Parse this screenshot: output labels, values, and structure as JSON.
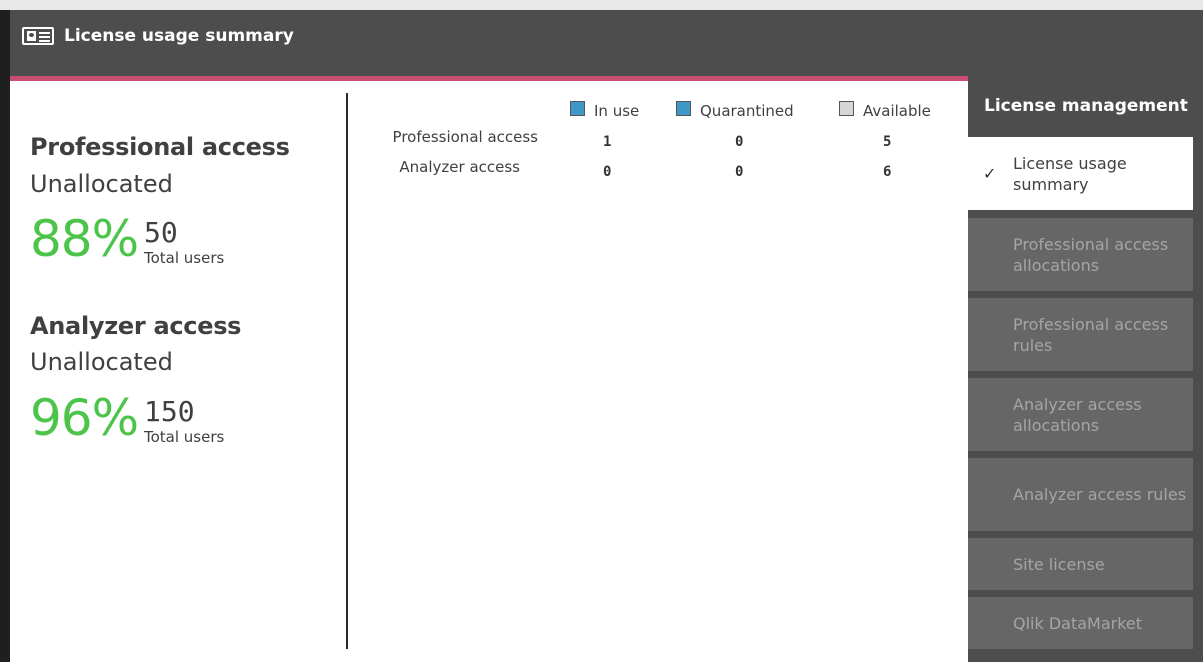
{
  "header": {
    "title": "License usage summary",
    "icon": "id-card-icon"
  },
  "summary": {
    "professional": {
      "title": "Professional access",
      "status": "Unallocated",
      "percent": "88%",
      "total": "50",
      "total_label": "Total users"
    },
    "analyzer": {
      "title": "Analyzer access",
      "status": "Unallocated",
      "percent": "96%",
      "total": "150",
      "total_label": "Total users"
    }
  },
  "table": {
    "legend": [
      {
        "label": "In use",
        "color": "#3d97c7"
      },
      {
        "label": "Quarantined",
        "color": "#3d97c7"
      },
      {
        "label": "Available",
        "color": "#d6d6d6"
      }
    ],
    "rows": [
      {
        "label": "Professional access",
        "values": [
          "1",
          "0",
          "5"
        ]
      },
      {
        "label": "Analyzer access",
        "values": [
          "0",
          "0",
          "6"
        ]
      }
    ]
  },
  "sidebar": {
    "title": "License management",
    "items": [
      {
        "label": "License usage summary",
        "active": true
      },
      {
        "label": "Professional access allocations",
        "active": false
      },
      {
        "label": "Professional access rules",
        "active": false
      },
      {
        "label": "Analyzer access allocations",
        "active": false
      },
      {
        "label": "Analyzer access rules",
        "active": false
      },
      {
        "label": "Site license",
        "active": false
      },
      {
        "label": "Qlik DataMarket",
        "active": false
      }
    ]
  },
  "colors": {
    "accent": "#c94f72",
    "percent_green": "#4cc44a",
    "header_bg": "#4d4d4d"
  }
}
